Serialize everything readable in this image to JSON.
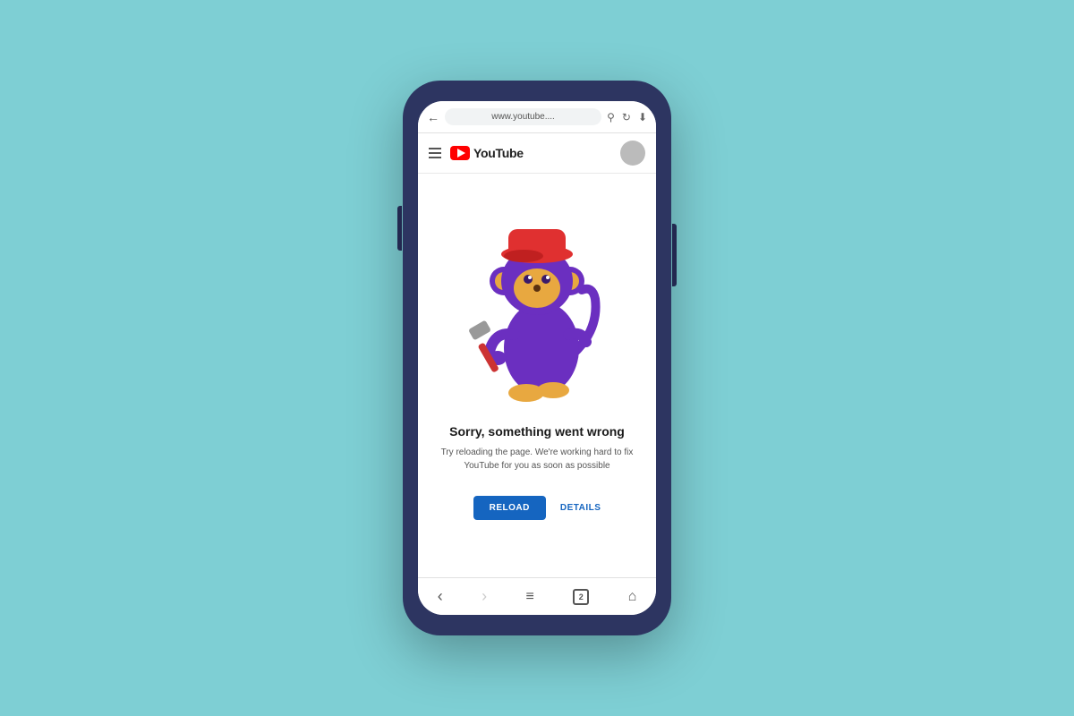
{
  "background": {
    "color": "#7ecfd4"
  },
  "phone": {
    "body_color": "#2d3561"
  },
  "browser": {
    "url_text": "www.youtube....",
    "back_icon": "←",
    "search_icon": "⌕",
    "refresh_icon": "↻",
    "download_icon": "⬇"
  },
  "youtube_header": {
    "logo_text": "YouTube",
    "menu_icon": "hamburger",
    "avatar_icon": "avatar"
  },
  "error_page": {
    "title": "Sorry, something went wrong",
    "subtitle": "Try reloading the page. We're working hard to fix YouTube for you as soon as possible",
    "reload_label": "RELOAD",
    "details_label": "DETAILS"
  },
  "bottom_nav": {
    "back_icon": "‹",
    "forward_icon": "›",
    "menu_icon": "≡",
    "tabs_count": "2",
    "home_icon": "⌂"
  },
  "monkey": {
    "body_color": "#6b2fc0",
    "face_color": "#e8a840",
    "hat_color": "#e03030"
  }
}
